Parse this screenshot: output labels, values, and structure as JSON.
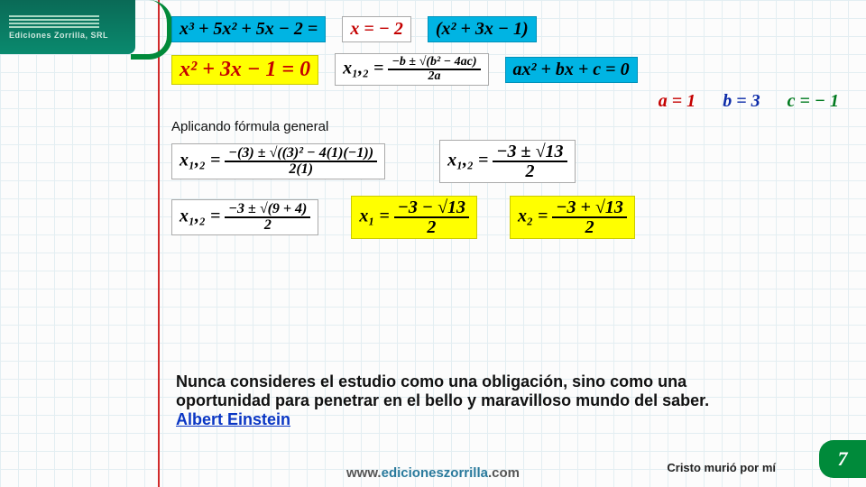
{
  "slide": {
    "brand": "Ediciones Zorrilla, SRL",
    "row1": {
      "cubic": "x³ + 5x² + 5x − 2 =",
      "root": "x = − 2",
      "factor": "(x² + 3x − 1)"
    },
    "row2": {
      "quad": "x² + 3x − 1 = 0",
      "formula_left": "x₁,₂ =",
      "formula_num": "−b ± √(b² − 4ac)",
      "formula_den": "2a",
      "std": "ax² + bx + c = 0"
    },
    "coefs": {
      "a": "a = 1",
      "b": "b = 3",
      "c": "c = − 1"
    },
    "note": "Aplicando fórmula general",
    "step1": {
      "lhs": "x₁,₂ =",
      "num": "−(3) ± √((3)² − 4(1)(−1))",
      "den": "2(1)"
    },
    "step1r": {
      "lhs": "x₁,₂ =",
      "num": "−3 ± √13",
      "den": "2"
    },
    "step2": {
      "lhs": "x₁,₂ =",
      "num": "−3 ± √(9 + 4)",
      "den": "2"
    },
    "sol1": {
      "lhs": "x₁ =",
      "num": "−3 − √13",
      "den": "2"
    },
    "sol2": {
      "lhs": "x₂ =",
      "num": "−3 + √13",
      "den": "2"
    },
    "quote": "Nunca consideres el estudio como una obligación, sino como una oportunidad para penetrar en el bello y maravilloso mundo del saber.",
    "author": "Albert Einstein",
    "footer_site": "www.edicioneszorrilla.com",
    "footer_phrase": "Cristo murió por mí",
    "page": "7"
  }
}
